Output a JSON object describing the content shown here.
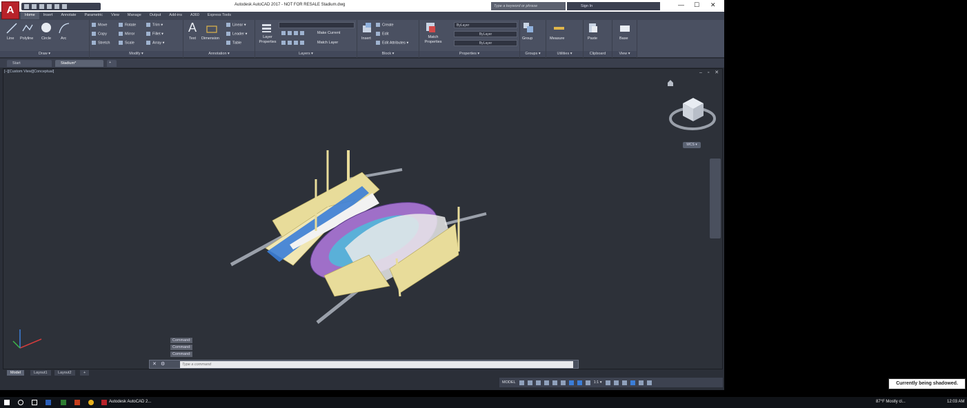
{
  "window": {
    "app_letter": "A",
    "title": "Autodesk AutoCAD 2017 - NOT FOR RESALE    Stadium.dwg",
    "search_placeholder": "Type a keyword or phrase",
    "sign_in": "Sign In",
    "controls": [
      "—",
      "☐",
      "✕"
    ]
  },
  "ribbon_tabs": [
    "Home",
    "Insert",
    "Annotate",
    "Parametric",
    "View",
    "Manage",
    "Output",
    "Add-ins",
    "A360",
    "Express Tools"
  ],
  "ribbon": {
    "draw": {
      "title": "Draw ▾",
      "tools": [
        "Line",
        "Polyline",
        "Circle",
        "Arc"
      ]
    },
    "modify": {
      "title": "Modify ▾",
      "tools": [
        "Move",
        "Rotate",
        "Trim ▾",
        "Copy",
        "Mirror",
        "Fillet ▾",
        "Stretch",
        "Scale",
        "Array ▾"
      ]
    },
    "annotation": {
      "title": "Annotation ▾",
      "tools": [
        "Text",
        "Dimension",
        "Linear ▾",
        "Leader ▾",
        "Table"
      ]
    },
    "layers": {
      "title": "Layers ▾",
      "tools": [
        "Layer Properties",
        "Make Current",
        "Match Layer"
      ]
    },
    "block": {
      "title": "Block ▾",
      "tools": [
        "Insert",
        "Create",
        "Edit",
        "Edit Attributes ▾"
      ]
    },
    "properties": {
      "title": "Properties ▾",
      "tools": [
        "Match Properties"
      ],
      "combos": [
        "ByLayer",
        "ByLayer",
        "ByLayer"
      ]
    },
    "groups": {
      "title": "Groups ▾",
      "tools": [
        "Group"
      ]
    },
    "utilities": {
      "title": "Utilities ▾",
      "tools": [
        "Measure"
      ]
    },
    "clipboard": {
      "title": "Clipboard",
      "tools": [
        "Paste"
      ]
    },
    "view": {
      "title": "View ▾",
      "tools": [
        "Base"
      ]
    }
  },
  "file_tabs": [
    "Start",
    "Stadium*",
    "+"
  ],
  "viewport": {
    "label": "[–][Custom View][Conceptual]",
    "controls": "– ▫ ✕",
    "viewcube_faces": [
      "TOP",
      "FRONT",
      "RIGHT"
    ],
    "wcs": "WCS ▾"
  },
  "command": {
    "history": [
      "Command:",
      "Command:",
      "Command:"
    ],
    "placeholder": "Type a command"
  },
  "layout_tabs": [
    "Model",
    "Layout1",
    "Layout2",
    "+"
  ],
  "status": {
    "model": "MODEL",
    "scale": "1:1 ▾"
  },
  "shadow_notice": "Currently being shadowed.",
  "taskbar": {
    "app": "Autodesk AutoCAD 2...",
    "weather": "87°F  Mostly cl...",
    "time": "12:03 AM"
  },
  "colors": {
    "accent": "#3b7ed8",
    "field": "#5ab0d8",
    "track": "#8a5ab8",
    "structure": "#e8dc9a"
  }
}
